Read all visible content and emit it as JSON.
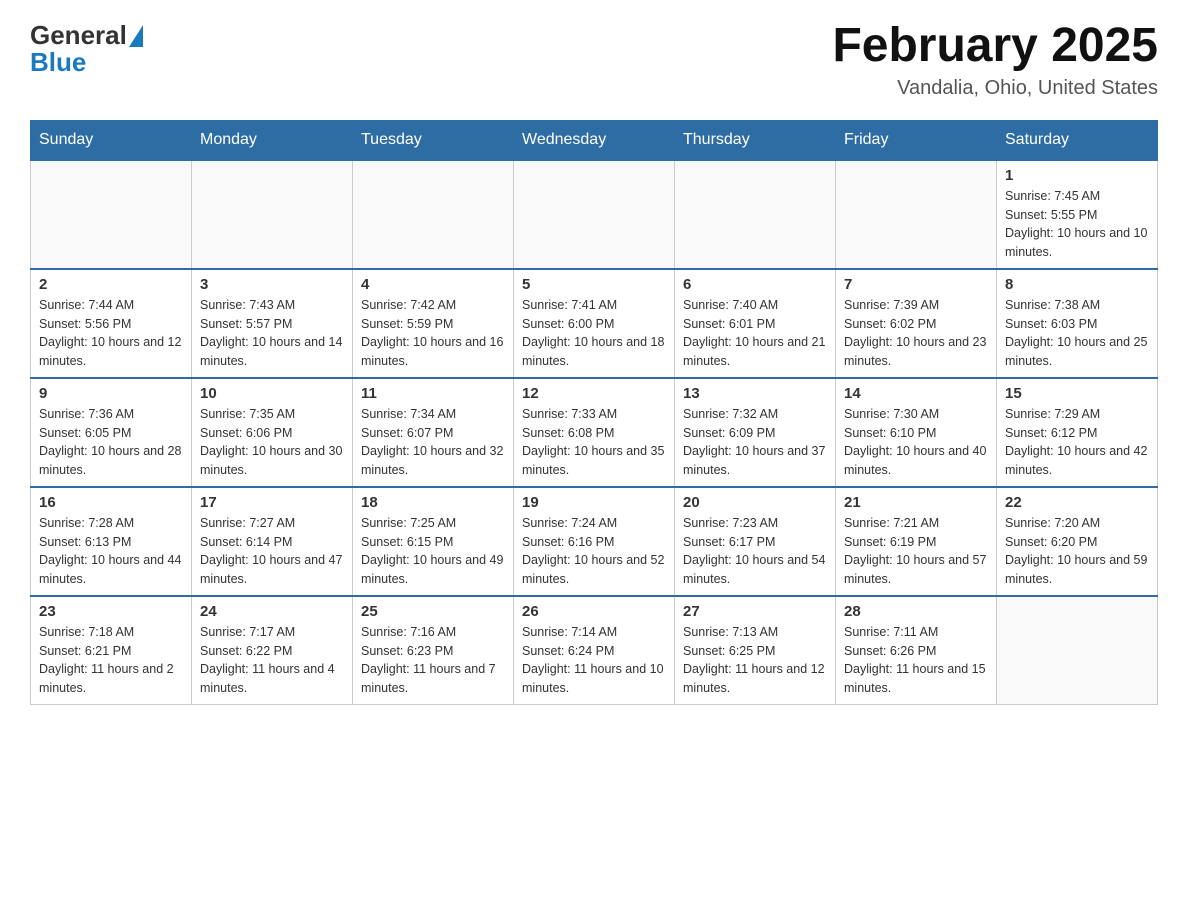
{
  "logo": {
    "general": "General",
    "blue": "Blue"
  },
  "header": {
    "title": "February 2025",
    "location": "Vandalia, Ohio, United States"
  },
  "days_of_week": [
    "Sunday",
    "Monday",
    "Tuesday",
    "Wednesday",
    "Thursday",
    "Friday",
    "Saturday"
  ],
  "weeks": [
    [
      {
        "date": "",
        "info": ""
      },
      {
        "date": "",
        "info": ""
      },
      {
        "date": "",
        "info": ""
      },
      {
        "date": "",
        "info": ""
      },
      {
        "date": "",
        "info": ""
      },
      {
        "date": "",
        "info": ""
      },
      {
        "date": "1",
        "info": "Sunrise: 7:45 AM\nSunset: 5:55 PM\nDaylight: 10 hours and 10 minutes."
      }
    ],
    [
      {
        "date": "2",
        "info": "Sunrise: 7:44 AM\nSunset: 5:56 PM\nDaylight: 10 hours and 12 minutes."
      },
      {
        "date": "3",
        "info": "Sunrise: 7:43 AM\nSunset: 5:57 PM\nDaylight: 10 hours and 14 minutes."
      },
      {
        "date": "4",
        "info": "Sunrise: 7:42 AM\nSunset: 5:59 PM\nDaylight: 10 hours and 16 minutes."
      },
      {
        "date": "5",
        "info": "Sunrise: 7:41 AM\nSunset: 6:00 PM\nDaylight: 10 hours and 18 minutes."
      },
      {
        "date": "6",
        "info": "Sunrise: 7:40 AM\nSunset: 6:01 PM\nDaylight: 10 hours and 21 minutes."
      },
      {
        "date": "7",
        "info": "Sunrise: 7:39 AM\nSunset: 6:02 PM\nDaylight: 10 hours and 23 minutes."
      },
      {
        "date": "8",
        "info": "Sunrise: 7:38 AM\nSunset: 6:03 PM\nDaylight: 10 hours and 25 minutes."
      }
    ],
    [
      {
        "date": "9",
        "info": "Sunrise: 7:36 AM\nSunset: 6:05 PM\nDaylight: 10 hours and 28 minutes."
      },
      {
        "date": "10",
        "info": "Sunrise: 7:35 AM\nSunset: 6:06 PM\nDaylight: 10 hours and 30 minutes."
      },
      {
        "date": "11",
        "info": "Sunrise: 7:34 AM\nSunset: 6:07 PM\nDaylight: 10 hours and 32 minutes."
      },
      {
        "date": "12",
        "info": "Sunrise: 7:33 AM\nSunset: 6:08 PM\nDaylight: 10 hours and 35 minutes."
      },
      {
        "date": "13",
        "info": "Sunrise: 7:32 AM\nSunset: 6:09 PM\nDaylight: 10 hours and 37 minutes."
      },
      {
        "date": "14",
        "info": "Sunrise: 7:30 AM\nSunset: 6:10 PM\nDaylight: 10 hours and 40 minutes."
      },
      {
        "date": "15",
        "info": "Sunrise: 7:29 AM\nSunset: 6:12 PM\nDaylight: 10 hours and 42 minutes."
      }
    ],
    [
      {
        "date": "16",
        "info": "Sunrise: 7:28 AM\nSunset: 6:13 PM\nDaylight: 10 hours and 44 minutes."
      },
      {
        "date": "17",
        "info": "Sunrise: 7:27 AM\nSunset: 6:14 PM\nDaylight: 10 hours and 47 minutes."
      },
      {
        "date": "18",
        "info": "Sunrise: 7:25 AM\nSunset: 6:15 PM\nDaylight: 10 hours and 49 minutes."
      },
      {
        "date": "19",
        "info": "Sunrise: 7:24 AM\nSunset: 6:16 PM\nDaylight: 10 hours and 52 minutes."
      },
      {
        "date": "20",
        "info": "Sunrise: 7:23 AM\nSunset: 6:17 PM\nDaylight: 10 hours and 54 minutes."
      },
      {
        "date": "21",
        "info": "Sunrise: 7:21 AM\nSunset: 6:19 PM\nDaylight: 10 hours and 57 minutes."
      },
      {
        "date": "22",
        "info": "Sunrise: 7:20 AM\nSunset: 6:20 PM\nDaylight: 10 hours and 59 minutes."
      }
    ],
    [
      {
        "date": "23",
        "info": "Sunrise: 7:18 AM\nSunset: 6:21 PM\nDaylight: 11 hours and 2 minutes."
      },
      {
        "date": "24",
        "info": "Sunrise: 7:17 AM\nSunset: 6:22 PM\nDaylight: 11 hours and 4 minutes."
      },
      {
        "date": "25",
        "info": "Sunrise: 7:16 AM\nSunset: 6:23 PM\nDaylight: 11 hours and 7 minutes."
      },
      {
        "date": "26",
        "info": "Sunrise: 7:14 AM\nSunset: 6:24 PM\nDaylight: 11 hours and 10 minutes."
      },
      {
        "date": "27",
        "info": "Sunrise: 7:13 AM\nSunset: 6:25 PM\nDaylight: 11 hours and 12 minutes."
      },
      {
        "date": "28",
        "info": "Sunrise: 7:11 AM\nSunset: 6:26 PM\nDaylight: 11 hours and 15 minutes."
      },
      {
        "date": "",
        "info": ""
      }
    ]
  ]
}
